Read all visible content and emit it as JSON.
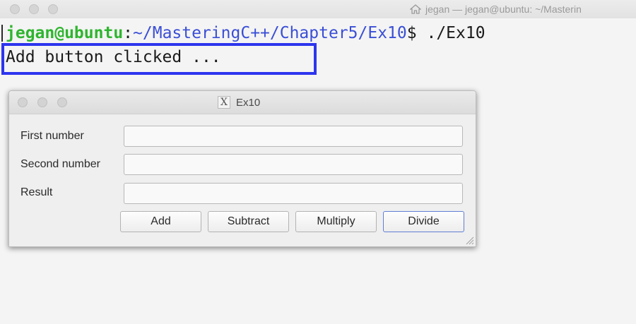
{
  "terminal": {
    "title": "jegan — jegan@ubuntu: ~/Masterin",
    "prompt": {
      "user_host": "jegan@ubuntu",
      "colon": ":",
      "path": "~/MasteringC++/Chapter5/Ex10",
      "symbol": "$",
      "command": " ./Ex10"
    },
    "output_line": "Add button clicked ...",
    "highlight_color": "#2d35ee"
  },
  "app_window": {
    "title": "Ex10",
    "title_icon": "x11-icon",
    "fields": [
      {
        "label": "First number",
        "value": ""
      },
      {
        "label": "Second number",
        "value": ""
      },
      {
        "label": "Result",
        "value": ""
      }
    ],
    "buttons": [
      {
        "label": "Add"
      },
      {
        "label": "Subtract"
      },
      {
        "label": "Multiply"
      },
      {
        "label": "Divide"
      }
    ]
  },
  "colors": {
    "prompt_user": "#2fb52f",
    "prompt_path": "#3a4fd6",
    "focus_border": "#5f7ed4"
  }
}
